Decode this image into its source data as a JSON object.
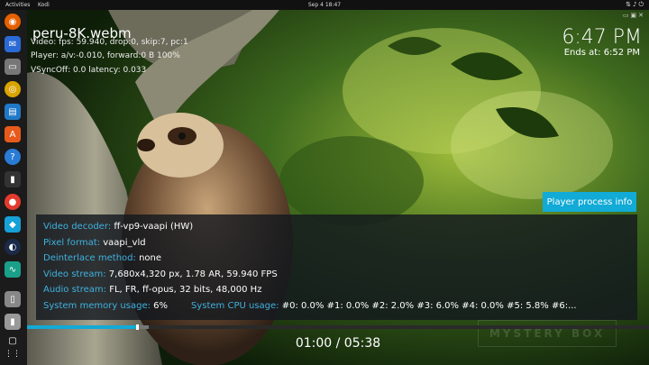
{
  "topbar": {
    "activities": "Activities",
    "app_name": "Kodi",
    "clock": "Sep 4  18:47",
    "tray_icons": [
      "network-icon",
      "volume-icon",
      "power-icon"
    ]
  },
  "dock": {
    "items": [
      "firefox-icon",
      "thunderbird-icon",
      "files-icon",
      "rhythmbox-icon",
      "writer-icon",
      "software-icon",
      "help-icon",
      "terminal-icon",
      "chrome-icon",
      "kodi-icon",
      "steam-icon",
      "monitor-icon",
      "usb-icon",
      "drive-icon",
      "trash-icon",
      "apps-grid-icon"
    ]
  },
  "osd": {
    "title": "peru-8K.webm",
    "debug_lines": [
      "Video: fps: 59.940, drop:0, skip:7, pc:1",
      "Player: a/v:-0.010, forward:0 B 100%",
      "VSyncOff: 0.0 latency: 0.033"
    ],
    "clock": "6:47 PM",
    "ends_at": "Ends at: 6:52 PM",
    "player_process_info": "Player process info"
  },
  "info": {
    "video_decoder": {
      "label": "Video decoder:",
      "value": "ff-vp9-vaapi (HW)"
    },
    "pixel_format": {
      "label": "Pixel format:",
      "value": "vaapi_vld"
    },
    "deinterlace": {
      "label": "Deinterlace method:",
      "value": "none"
    },
    "video_stream": {
      "label": "Video stream:",
      "value": "7,680x4,320 px, 1.78 AR, 59.940 FPS"
    },
    "audio_stream": {
      "label": "Audio stream:",
      "value": "FL, FR, ff-opus, 32 bits, 48,000 Hz"
    },
    "memory": {
      "label": "System memory usage:",
      "value": "6%"
    },
    "cpu": {
      "label": "System CPU usage:",
      "value": "#0: 0.0% #1: 0.0% #2: 2.0% #3: 6.0% #4: 0.0% #5: 5.8% #6:..."
    }
  },
  "playback": {
    "position": "01:00 / 05:38",
    "progress": 0.1775,
    "cached": 0.195
  },
  "watermark": "MYSTERY BOX",
  "colors": {
    "accent": "#12aad6",
    "label": "#3fb2e0"
  }
}
